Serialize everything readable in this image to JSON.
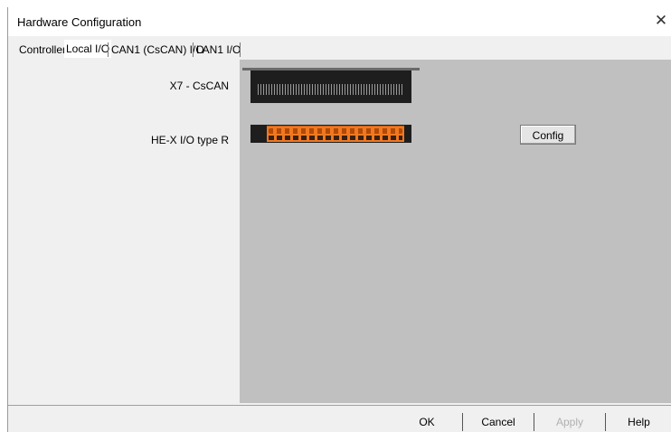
{
  "window": {
    "title": "Hardware Configuration",
    "close_glyph": "✕"
  },
  "tabs": [
    {
      "label": "Controller",
      "active": false
    },
    {
      "label": "Local I/O",
      "active": true
    },
    {
      "label": "CAN1 (CsCAN) I/O",
      "active": false
    },
    {
      "label": "LAN1 I/O",
      "active": false
    }
  ],
  "modules": [
    {
      "label": "X7 - CsCAN"
    },
    {
      "label": "HE-X I/O type R"
    }
  ],
  "config_button": {
    "label": "Config"
  },
  "footer": {
    "ok": "OK",
    "cancel": "Cancel",
    "apply": "Apply",
    "help": "Help"
  },
  "colors": {
    "device_panel": "#c0c0c0",
    "module_body": "#1e1e1e",
    "terminal_orange": "#f07820"
  }
}
